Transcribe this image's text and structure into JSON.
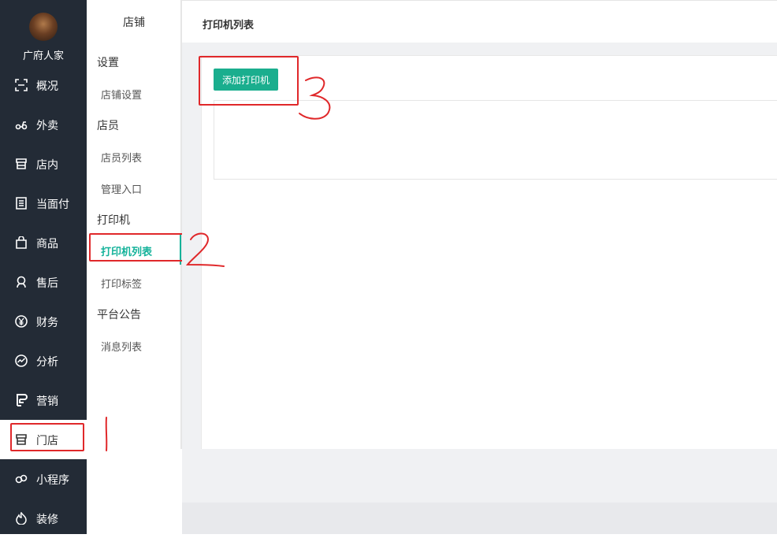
{
  "store": {
    "name": "广府人家"
  },
  "nav": [
    {
      "label": "概况",
      "icon": "overview-icon"
    },
    {
      "label": "外卖",
      "icon": "delivery-icon"
    },
    {
      "label": "店内",
      "icon": "store-icon"
    },
    {
      "label": "当面付",
      "icon": "receipt-icon"
    },
    {
      "label": "商品",
      "icon": "bag-icon"
    },
    {
      "label": "售后",
      "icon": "support-icon"
    },
    {
      "label": "财务",
      "icon": "yen-icon"
    },
    {
      "label": "分析",
      "icon": "chart-icon"
    },
    {
      "label": "营销",
      "icon": "marketing-icon"
    },
    {
      "label": "门店",
      "icon": "shop-icon"
    },
    {
      "label": "小程序",
      "icon": "miniprogram-icon"
    },
    {
      "label": "装修",
      "icon": "decor-icon"
    }
  ],
  "nav_active": "门店",
  "submenu": {
    "title": "店铺",
    "groups": [
      {
        "label": "设置",
        "items": [
          "店铺设置"
        ]
      },
      {
        "label": "店员",
        "items": [
          "店员列表",
          "管理入口"
        ]
      },
      {
        "label": "打印机",
        "items": [
          "打印机列表",
          "打印标签"
        ]
      },
      {
        "label": "平台公告",
        "items": [
          "消息列表"
        ]
      }
    ],
    "active": "打印机列表"
  },
  "main": {
    "title": "打印机列表",
    "add_button": "添加打印机"
  },
  "annotations": [
    "1",
    "2",
    "3"
  ],
  "colors": {
    "accent": "#1aae8e",
    "sidebar": "#232b36",
    "annotation": "#e0282a"
  }
}
